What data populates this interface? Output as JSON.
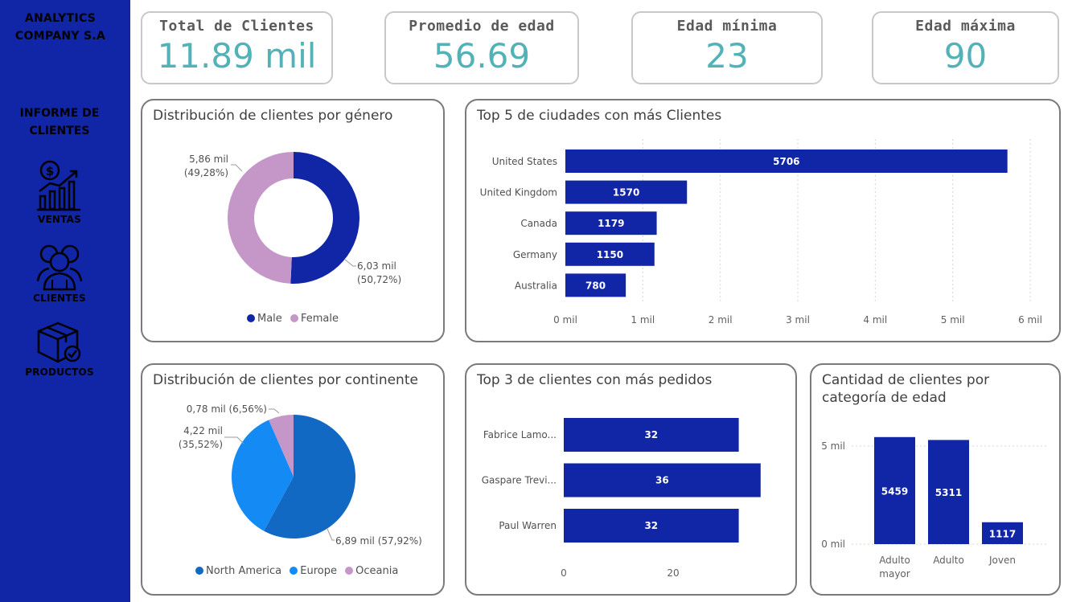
{
  "sidebar": {
    "brand_line1": "ANALYTICS",
    "brand_line2": "COMPANY S.A",
    "report_line1": "INFORME DE",
    "report_line2": "CLIENTES",
    "nav": [
      {
        "label": "VENTAS",
        "icon": "sales-chart-icon"
      },
      {
        "label": "CLIENTES",
        "icon": "customers-icon"
      },
      {
        "label": "PRODUCTOS",
        "icon": "product-box-icon"
      }
    ],
    "bg_color": "#1126a6"
  },
  "kpis": [
    {
      "title": "Total de Clientes",
      "value": "11.89 mil"
    },
    {
      "title": "Promedio de edad",
      "value": "56.69"
    },
    {
      "title": "Edad mínima",
      "value": "23"
    },
    {
      "title": "Edad máxima",
      "value": "90"
    }
  ],
  "colors": {
    "kpi_value": "#52b2b8",
    "bar": "#1126a6",
    "male": "#1126a6",
    "female": "#c597c9",
    "north_america": "#1269c4",
    "europe": "#148af5",
    "oceania": "#c597c9"
  },
  "chart_data": [
    {
      "id": "gender",
      "type": "pie",
      "title": "Distribución de clientes por género",
      "donut": true,
      "slices": [
        {
          "name": "Male",
          "value": 6.03,
          "percent": 50.72,
          "label": "6,03 mil",
          "label2": "(50,72%)"
        },
        {
          "name": "Female",
          "value": 5.86,
          "percent": 49.28,
          "label": "5,86 mil",
          "label2": "(49,28%)"
        }
      ],
      "legend": [
        "Male",
        "Female"
      ],
      "legend_position": "bottom"
    },
    {
      "id": "cities",
      "type": "bar",
      "orientation": "horizontal",
      "title": "Top 5 de ciudades con más Clientes",
      "categories": [
        "United States",
        "United Kingdom",
        "Canada",
        "Germany",
        "Australia"
      ],
      "values": [
        5706,
        1570,
        1179,
        1150,
        780
      ],
      "xlim": [
        0,
        6000
      ],
      "ticks": [
        0,
        1000,
        2000,
        3000,
        4000,
        5000,
        6000
      ],
      "tick_labels": [
        "0 mil",
        "1 mil",
        "2 mil",
        "3 mil",
        "4 mil",
        "5 mil",
        "6 mil"
      ],
      "grid": true
    },
    {
      "id": "continents",
      "type": "pie",
      "title": "Distribución de clientes por continente",
      "slices": [
        {
          "name": "North America",
          "value": 6.89,
          "percent": 57.92,
          "label": "6,89 mil (57,92%)"
        },
        {
          "name": "Europe",
          "value": 4.22,
          "percent": 35.52,
          "label": "4,22 mil",
          "label2": "(35,52%)"
        },
        {
          "name": "Oceania",
          "value": 0.78,
          "percent": 6.56,
          "label": "0,78 mil (6,56%)"
        }
      ],
      "legend": [
        "North America",
        "Europe",
        "Oceania"
      ],
      "legend_position": "bottom"
    },
    {
      "id": "top_customers",
      "type": "bar",
      "orientation": "horizontal",
      "title": "Top 3 de clientes con más pedidos",
      "categories": [
        "Fabrice Lamo...",
        "Gaspare Trevi...",
        "Paul Warren"
      ],
      "values": [
        32,
        36,
        32
      ],
      "xlim": [
        0,
        40
      ],
      "ticks": [
        0,
        20
      ],
      "tick_labels": [
        "0",
        "20"
      ]
    },
    {
      "id": "age_category",
      "type": "bar",
      "orientation": "vertical",
      "title_line1": "Cantidad de clientes por",
      "title_line2": "categoría de edad",
      "categories": [
        [
          "Adulto",
          "mayor"
        ],
        [
          "Adulto"
        ],
        [
          "Joven"
        ]
      ],
      "values": [
        5459,
        5311,
        1117
      ],
      "ylim": [
        0,
        5000
      ],
      "ticks": [
        0,
        5000
      ],
      "tick_labels": [
        "0 mil",
        "5 mil"
      ],
      "grid": true
    }
  ]
}
